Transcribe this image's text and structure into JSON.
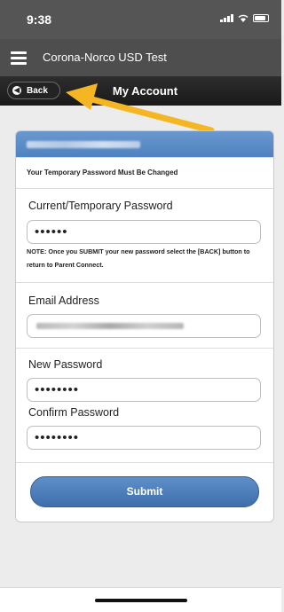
{
  "status_bar": {
    "time": "9:38"
  },
  "app_bar": {
    "title": "Corona-Norco USD Test"
  },
  "nav_bar": {
    "back_label": "Back",
    "title": "My Account"
  },
  "form": {
    "notice": "Your Temporary Password Must Be Changed",
    "current_password_label": "Current/Temporary Password",
    "current_password_value": "••••••",
    "note": "NOTE: Once you SUBMIT your new password select the [BACK] button to return to Parent Connect.",
    "email_label": "Email Address",
    "new_password_label": "New Password",
    "new_password_value": "••••••••",
    "confirm_password_label": "Confirm Password",
    "confirm_password_value": "••••••••",
    "submit_label": "Submit"
  },
  "colors": {
    "accent": "#4f82c0",
    "arrow": "#f5b623"
  }
}
